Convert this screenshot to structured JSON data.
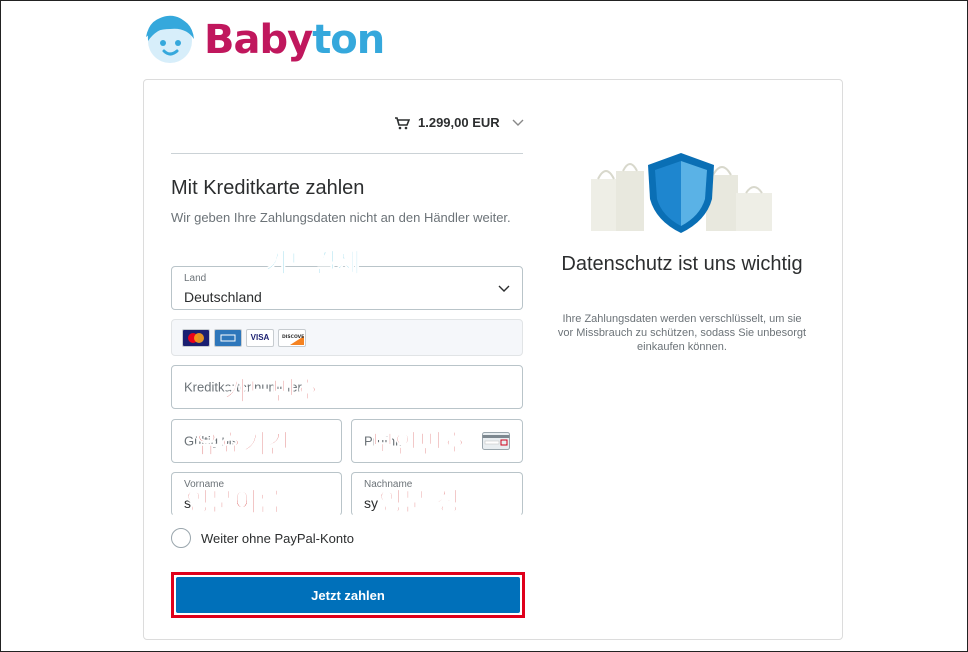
{
  "brand": {
    "name_part1": "Baby",
    "name_part2": "ton"
  },
  "cart": {
    "amount": "1.299,00 EUR"
  },
  "form": {
    "title": "Mit Kreditkarte zahlen",
    "subtitle": "Wir geben Ihre Zahlungsdaten nicht an den Händler weiter.",
    "country": {
      "label": "Land",
      "value": "Deutschland"
    },
    "card_brands": [
      "MasterCard",
      "AMEX",
      "VISA",
      "DISCOVER"
    ],
    "card_number": {
      "placeholder": "Kreditkartennummer"
    },
    "expiry": {
      "placeholder": "Gültig bis"
    },
    "cvv": {
      "placeholder": "Prüfnr."
    },
    "first_name": {
      "label": "Vorname",
      "value": "s"
    },
    "last_name": {
      "label": "Nachname",
      "value": "sy"
    },
    "guest_option": "Weiter ohne PayPal-Konto",
    "submit_label": "Jetzt zahlen"
  },
  "annotations": {
    "card_payment": "카드결제",
    "card_number": "카드번호",
    "expiry": "유효기간",
    "security_code": "보안번호",
    "first_name_en": "영문이름",
    "last_name_en": "영문 성"
  },
  "privacy": {
    "title": "Datenschutz ist uns wichtig",
    "text": "Ihre Zahlungsdaten werden verschlüsselt, um sie vor Missbrauch zu schützen, sodass Sie unbesorgt einkaufen können."
  },
  "colors": {
    "primary_button": "#0070ba",
    "highlight_border": "#e0001b",
    "annotation_red": "#c40000",
    "annotation_cyan": "#2ab3d6",
    "logo_magenta": "#c0175d",
    "logo_blue": "#35a8dc"
  },
  "icons": [
    "cart-icon",
    "chevron-down-icon",
    "shield-icon",
    "cvv-card-icon",
    "logo-face-icon"
  ]
}
